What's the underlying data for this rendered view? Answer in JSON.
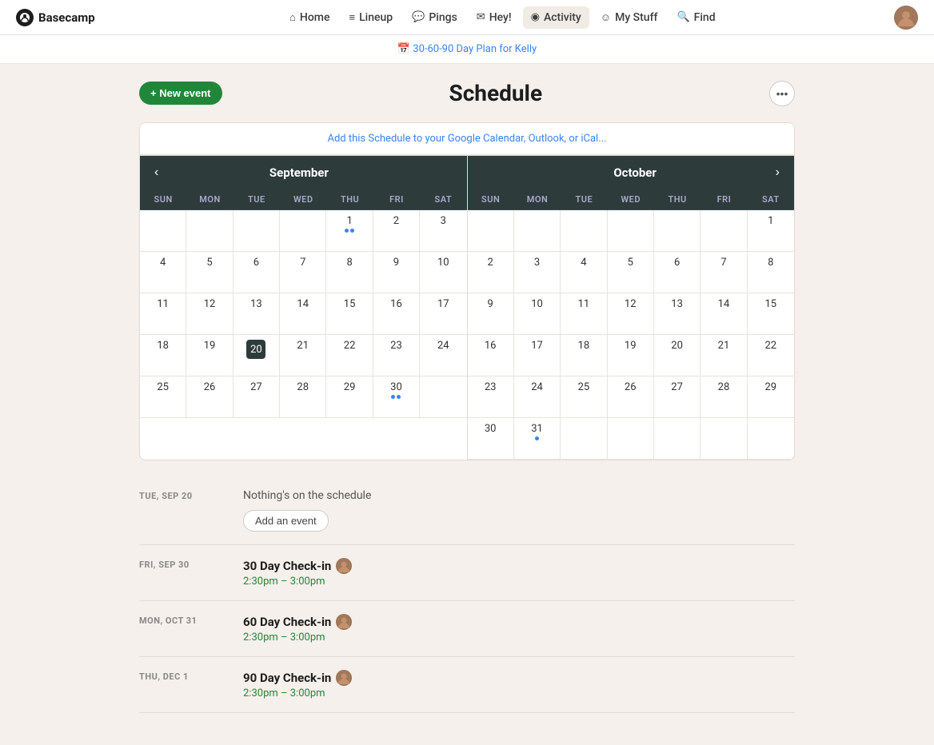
{
  "app": {
    "logo_text": "Basecamp"
  },
  "nav": {
    "links": [
      {
        "id": "home",
        "label": "Home",
        "icon": "⌂"
      },
      {
        "id": "lineup",
        "label": "Lineup",
        "icon": "≡"
      },
      {
        "id": "pings",
        "label": "Pings",
        "icon": "💬"
      },
      {
        "id": "hey",
        "label": "Hey!",
        "icon": "✉"
      },
      {
        "id": "activity",
        "label": "Activity",
        "icon": "◉",
        "active": true
      },
      {
        "id": "mystuff",
        "label": "My Stuff",
        "icon": "☺"
      },
      {
        "id": "find",
        "label": "Find",
        "icon": "🔍"
      }
    ]
  },
  "breadcrumb": {
    "icon": "📅",
    "link_text": "30-60-90 Day Plan for Kelly",
    "link_href": "#"
  },
  "schedule": {
    "new_event_label": "+ New event",
    "title": "Schedule",
    "more_icon": "•••",
    "ical_link_text": "Add this Schedule to your Google Calendar, Outlook, or iCal..."
  },
  "september": {
    "month_name": "September",
    "day_headers": [
      "SUN",
      "MON",
      "TUE",
      "WED",
      "THU",
      "FRI",
      "SAT"
    ],
    "today": 20,
    "dots": [
      1,
      30
    ],
    "weeks": [
      [
        null,
        null,
        null,
        null,
        1,
        2,
        3
      ],
      [
        4,
        5,
        6,
        7,
        8,
        9,
        10
      ],
      [
        11,
        12,
        13,
        14,
        15,
        16,
        17
      ],
      [
        18,
        19,
        20,
        21,
        22,
        23,
        24
      ],
      [
        25,
        26,
        27,
        28,
        29,
        30,
        null
      ]
    ]
  },
  "october": {
    "month_name": "October",
    "day_headers": [
      "SUN",
      "MON",
      "TUE",
      "WED",
      "THU",
      "FRI",
      "SAT"
    ],
    "today": null,
    "dots": [
      31
    ],
    "weeks": [
      [
        null,
        null,
        null,
        null,
        null,
        null,
        1
      ],
      [
        2,
        3,
        4,
        5,
        6,
        7,
        8
      ],
      [
        9,
        10,
        11,
        12,
        13,
        14,
        15
      ],
      [
        16,
        17,
        18,
        19,
        20,
        21,
        22
      ],
      [
        23,
        24,
        25,
        26,
        27,
        28,
        29
      ],
      [
        30,
        31,
        null,
        null,
        null,
        null,
        null
      ]
    ]
  },
  "schedule_items": [
    {
      "day_label": "TUE, SEP 20",
      "type": "empty",
      "empty_text": "Nothing's on the schedule",
      "add_btn": "Add an event"
    },
    {
      "day_label": "FRI, SEP 30",
      "type": "event",
      "title": "30 Day Check-in",
      "time": "2:30pm – 3:00pm",
      "has_avatar": true
    },
    {
      "day_label": "MON, OCT 31",
      "type": "event",
      "title": "60 Day Check-in",
      "time": "2:30pm – 3:00pm",
      "has_avatar": true
    },
    {
      "day_label": "THU, DEC 1",
      "type": "event",
      "title": "90 Day Check-in",
      "time": "2:30pm – 3:00pm",
      "has_avatar": true
    }
  ]
}
